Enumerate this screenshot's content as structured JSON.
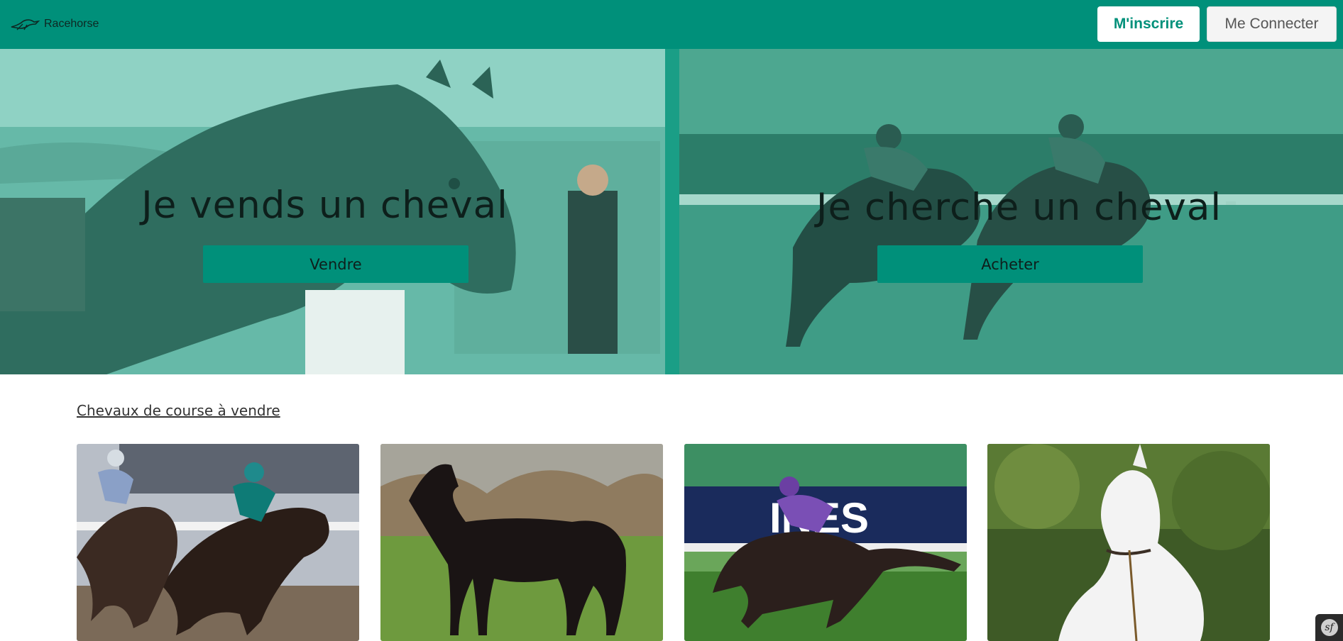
{
  "header": {
    "brand_name": "Racehorse",
    "signup_label": "M'inscrire",
    "login_label": "Me Connecter"
  },
  "hero": {
    "sell": {
      "title": "Je vends un cheval",
      "button": "Vendre"
    },
    "buy": {
      "title": "Je cherche un cheval",
      "button": "Acheter"
    }
  },
  "listing": {
    "section_link": "Chevaux de course à vendre",
    "cards": [
      {
        "image": "racing-horses-photo"
      },
      {
        "image": "dark-horse-standing-photo"
      },
      {
        "image": "racing-jockey-photo"
      },
      {
        "image": "white-horse-photo"
      }
    ]
  },
  "debug_badge": {
    "glyph": "sf"
  },
  "colors": {
    "accent": "#00907a",
    "hero_overlay": "#5fb3a1",
    "text_dark": "#0d1f1b"
  }
}
